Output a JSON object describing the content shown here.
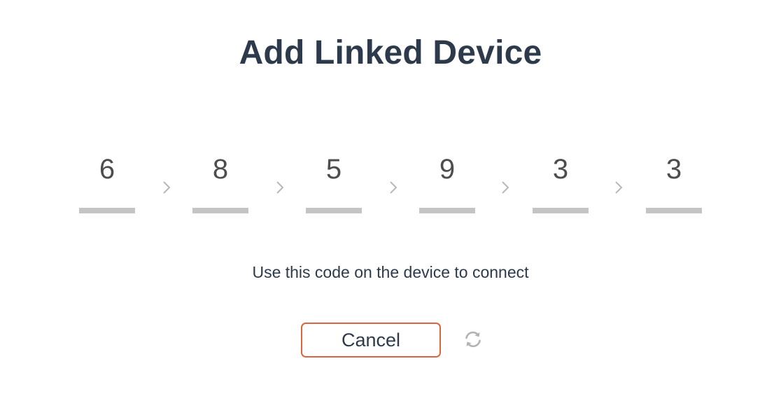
{
  "title": "Add Linked Device",
  "code": {
    "digits": [
      "6",
      "8",
      "5",
      "9",
      "3",
      "3"
    ]
  },
  "instruction": "Use this code on the device to connect",
  "actions": {
    "cancel_label": "Cancel",
    "refresh_icon": "refresh-icon"
  },
  "colors": {
    "title": "#2d3a4b",
    "digit": "#4d4d4d",
    "underline": "#c4c4c4",
    "separator": "#b8b8b8",
    "cancel_border": "#d9663f",
    "refresh_icon": "#b3b3b3"
  }
}
